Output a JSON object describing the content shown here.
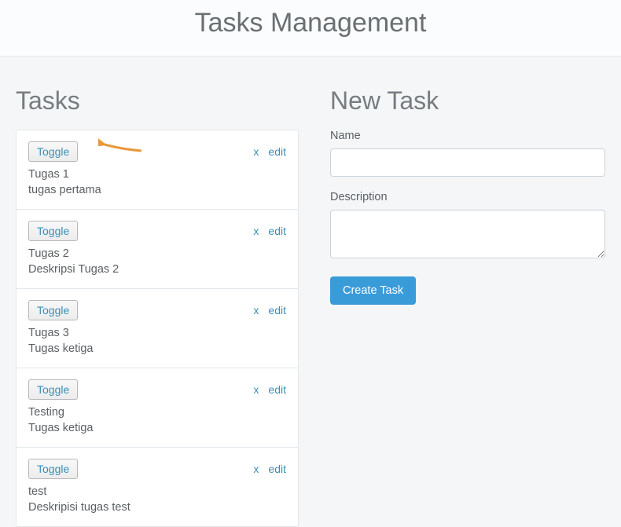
{
  "header": {
    "title": "Tasks Management"
  },
  "tasks_section": {
    "title": "Tasks",
    "toggle_label": "Toggle",
    "delete_label": "x",
    "edit_label": "edit",
    "items": [
      {
        "name": "Tugas 1",
        "desc": "tugas pertama"
      },
      {
        "name": "Tugas 2",
        "desc": "Deskripsi Tugas 2"
      },
      {
        "name": "Tugas 3",
        "desc": "Tugas ketiga"
      },
      {
        "name": "Testing",
        "desc": "Tugas ketiga"
      },
      {
        "name": "test",
        "desc": "Deskripisi tugas test"
      }
    ]
  },
  "form": {
    "title": "New Task",
    "name_label": "Name",
    "description_label": "Description",
    "name_value": "",
    "description_value": "",
    "submit_label": "Create Task"
  },
  "annotation": {
    "arrow_color": "#e8993b"
  }
}
